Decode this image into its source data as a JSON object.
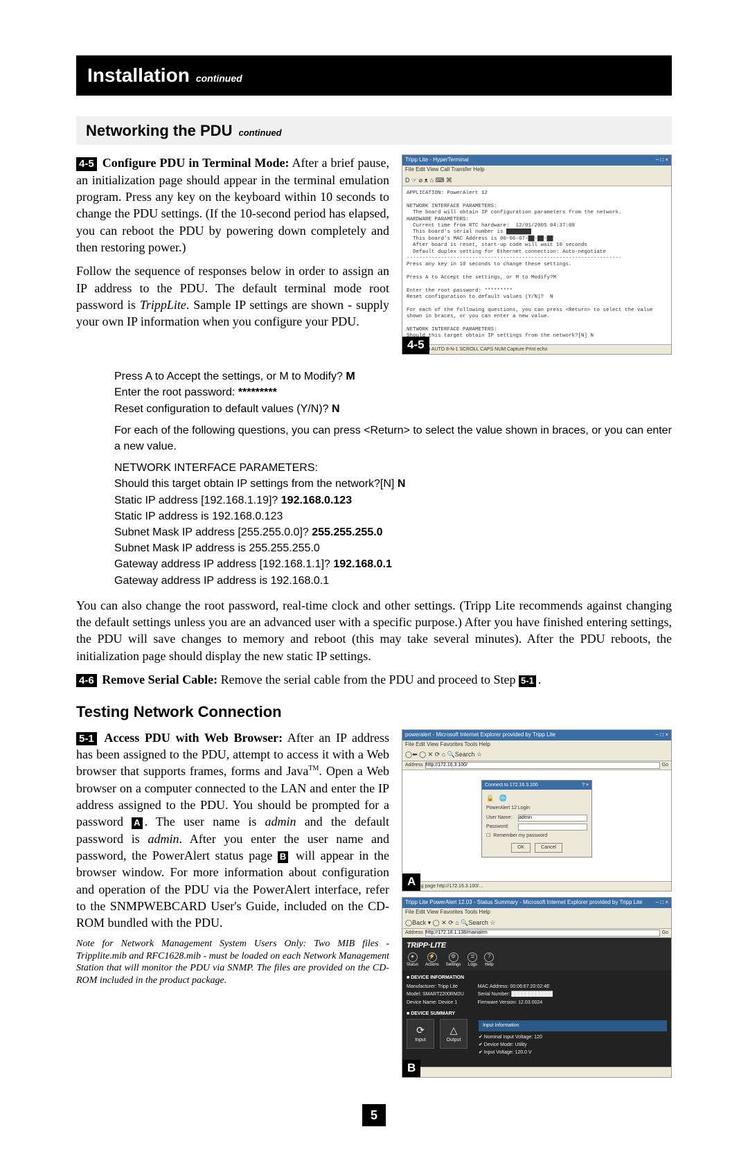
{
  "header": {
    "title": "Installation",
    "cont": "continued"
  },
  "section1": {
    "heading_main": "Networking the PDU",
    "heading_cont": "continued",
    "step45_badge": "4-5",
    "step45_bold": "Configure PDU in Terminal Mode:",
    "step45_body": " After a brief pause, an initialization page should appear in the terminal emulation program. Press any key on the keyboard within 10 seconds to change the PDU settings. (If the 10-second period has elapsed, you can reboot the PDU by powering down completely and then restoring power.)",
    "step45_p2a": "Follow the sequence of responses below in order to assign an IP address to the PDU. The default terminal mode root password is ",
    "step45_p2_italic": "TrippLite",
    "step45_p2b": ". Sample IP settings are shown - supply your own IP information when you configure your PDU.",
    "term": {
      "l1a": "Press A to Accept the settings, or M to Modify? ",
      "l1b": "M",
      "l2a": "Enter the root password: ",
      "l2b": "*********",
      "l3a": "Reset configuration to default values (Y/N)? ",
      "l3b": "N",
      "l4": "For each of the following questions, you can press <Return> to select the value shown in braces, or you can enter a new value.",
      "l5": "NETWORK INTERFACE PARAMETERS:",
      "l6a": "Should this target obtain IP settings from the network?[N] ",
      "l6b": "N",
      "l7a": "Static IP address [192.168.1.19]? ",
      "l7b": "192.168.0.123",
      "l8": "  Static IP address is 192.168.0.123",
      "l9a": "Subnet Mask IP address [255.255.0.0]? ",
      "l9b": "255.255.255.0",
      "l10": "  Subnet Mask IP address is 255.255.255.0",
      "l11a": "Gateway address IP address [192.168.1.1]? ",
      "l11b": "192.168.0.1",
      "l12": "  Gateway address IP address is 192.168.0.1"
    },
    "after_term": "You can also change the root password, real-time clock and other settings. (Tripp Lite recommends against changing the default settings unless you are an advanced user with a specific purpose.) After you have finished entering settings, the PDU will save changes to memory and reboot (this may take several minutes). After the PDU reboots, the initialization page should display the new static IP settings.",
    "step46_badge": "4-6",
    "step46_bold": "Remove Serial Cable:",
    "step46_body_a": " Remove the serial cable from the PDU and proceed to Step ",
    "step46_badge2": "5-1",
    "step46_body_b": "."
  },
  "scr45": {
    "title": "Tripp Lite - HyperTerminal",
    "menu": "File  Edit  View  Call  Transfer  Help",
    "toolbar": "D ☞  ⌀ ᴥ  ⌂ ⌨  ⌘",
    "body": "APPLICATION: PowerAlert 12\n\nNETWORK INTERFACE PARAMETERS:\n  The board will obtain IP configuration parameters from the network.\nHARDWARE PARAMETERS:\n  Current time from RTC hardware:  12/01/2005 04:37:08\n  This board's serial number is ████████\n  This board's MAC Address is 00-06-67-██-██-██\n  After board is reset, start-up code will wait 10 seconds\n  Default duplex setting for Ethernet connection: Auto-negotiate\n---------------------------------------------------------------------\nPress any key in 10 seconds to change these settings.\n\nPress A to Accept the settings, or M to Modify?M\n\nEnter the root password: *********\nReset configuration to default values (Y/N)?  N\n\nFor each of the following questions, you can press <Return> to select the value\nshown in braces, or you can enter a new value.\n\nNETWORK INTERFACE PARAMETERS:\nShould this target obtain IP settings from the network?[N] N",
    "status": "0:47        VT100        AUTO 8-N-1        SCROLL    CAPS    NUM    Capture    Print echo",
    "label": "4-5"
  },
  "section2": {
    "heading": "Testing Network Connection",
    "step51_badge": "5-1",
    "step51_bold": "Access PDU with Web Browser:",
    "step51_body_a": " After an IP address has been assigned to the PDU, attempt to access it with a Web browser that supports frames, forms and Java",
    "step51_tm": "TM",
    "step51_body_b": ". Open a Web browser on a computer connected to the LAN and enter the IP address assigned to the PDU. You should be prompted for a password ",
    "step51_badge_a": "A",
    "step51_body_c": ". The user name is ",
    "step51_admin1": "admin",
    "step51_body_d": " and the default password is ",
    "step51_admin2": "admin",
    "step51_body_e": ". After you enter the user name and password, the PowerAlert status page ",
    "step51_badge_b": "B",
    "step51_body_f": " will appear in the browser window. For more information about configuration and operation of the PDU via the PowerAlert interface, refer to the SNMPWEBCARD User's Guide, included on the CD-ROM bundled with the PDU.",
    "note": "Note for Network Management System Users Only: Two MIB files - Tripplite.mib and RFC1628.mib - must be loaded on each Network Management Station that will monitor the PDU via SNMP. The files are provided on the CD-ROM included in the product package."
  },
  "scrA": {
    "title": "poweralert - Microsoft Internet Explorer provided by Tripp Lite",
    "menu": "File  Edit  View  Favorites  Tools  Help",
    "addr_label": "Address",
    "addr": "http://172.16.3.100/",
    "go": "Go",
    "login_title": "Connect to 172.16.3.100",
    "login_sub": "PowerAlert 12 Login",
    "user_lbl": "User Name:",
    "user_val": "admin",
    "pass_lbl": "Password:",
    "remember": "Remember my password",
    "ok": "OK",
    "cancel": "Cancel",
    "status": "Opening page http://172.16.3.100/…",
    "label": "A"
  },
  "scrB": {
    "title": "Tripp Lite PowerAlert 12.03 - Status Summary - Microsoft Internet Explorer provided by Tripp Lite",
    "menu": "File  Edit  View  Favorites  Tools  Help",
    "addr_label": "Address",
    "addr": "http://172.18.1.138/mainalrm",
    "go": "Go",
    "logo": "TRIPP·LITE",
    "icons": [
      "Status",
      "Actions",
      "Settings",
      "Logs",
      "Help"
    ],
    "sec_info": "DEVICE INFORMATION",
    "info": {
      "mfr_k": "Manufacturer:",
      "mfr_v": "Tripp Lite",
      "mdl_k": "Model:",
      "mdl_v": "SMART2200RM2U",
      "dev_k": "Device Name:",
      "dev_v": "Device 1",
      "mac_k": "MAC Address:",
      "mac_v": "00:06:67:20:02:4E",
      "ser_k": "Serial Number:",
      "ser_v": "████████████",
      "fw_k": "Firmware Version:",
      "fw_v": "12.03.0024"
    },
    "sec_sum": "DEVICE SUMMARY",
    "card1": "Input",
    "card2": "Output",
    "input_info_h": "Input Information",
    "ii": {
      "k1": "Nominal Input Voltage:",
      "v1": "120",
      "k2": "Device Mode:",
      "v2": "Utility",
      "k3": "Input Voltage:",
      "v3": "120.0 V"
    },
    "status": "Done",
    "label": "B"
  },
  "page_number": "5"
}
